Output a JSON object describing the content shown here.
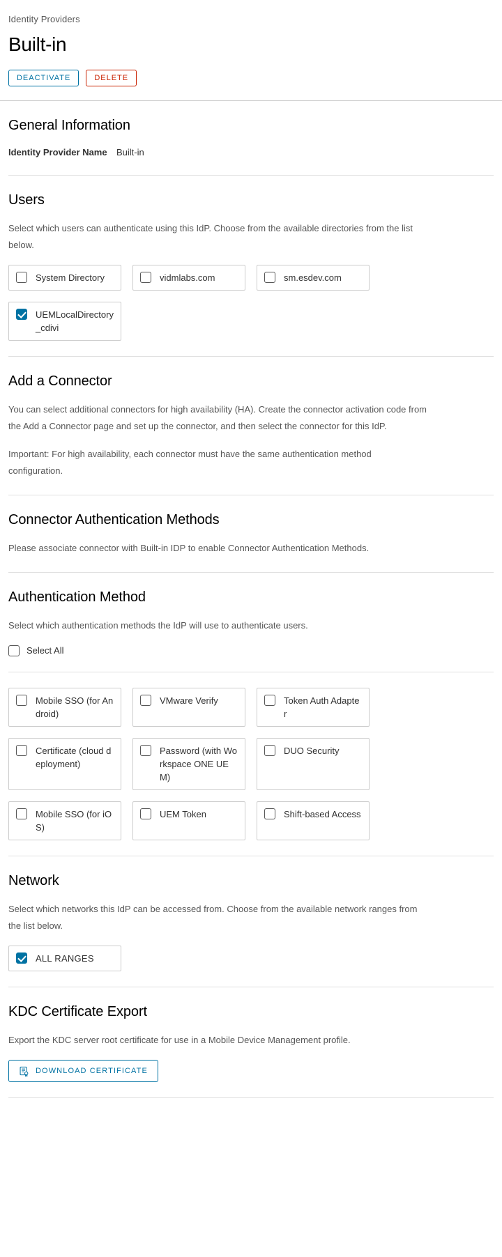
{
  "header": {
    "breadcrumb": "Identity Providers",
    "title": "Built-in",
    "deactivate_label": "DEACTIVATE",
    "delete_label": "DELETE"
  },
  "general_information": {
    "heading": "General Information",
    "idp_name_label": "Identity Provider Name",
    "idp_name_value": "Built-in"
  },
  "users": {
    "heading": "Users",
    "description": "Select which users can authenticate using this IdP. Choose from the available directories from the list below.",
    "directories": [
      {
        "label": "System Directory",
        "checked": false
      },
      {
        "label": "vidmlabs.com",
        "checked": false
      },
      {
        "label": "sm.esdev.com",
        "checked": false
      },
      {
        "label": "UEMLocalDirectory_cdivi",
        "checked": true
      }
    ]
  },
  "add_connector": {
    "heading": "Add a Connector",
    "description": "You can select additional connectors for high availability (HA). Create the connector activation code from the Add a Connector page and set up the connector, and then select the connector for this IdP.",
    "important": "Important: For high availability, each connector must have the same authentication method configuration."
  },
  "connector_auth_methods": {
    "heading": "Connector Authentication Methods",
    "description": "Please associate connector with Built-in IDP to enable Connector Authentication Methods."
  },
  "authentication_method": {
    "heading": "Authentication Method",
    "description": "Select which authentication methods the IdP will use to authenticate users.",
    "select_all_label": "Select All",
    "select_all_checked": false,
    "methods": [
      {
        "label": "Mobile SSO (for Android)",
        "checked": false
      },
      {
        "label": "VMware Verify",
        "checked": false
      },
      {
        "label": "Token Auth Adapter",
        "checked": false
      },
      {
        "label": "Certificate (cloud deployment)",
        "checked": false
      },
      {
        "label": "Password (with Workspace ONE UEM)",
        "checked": false
      },
      {
        "label": "DUO Security",
        "checked": false
      },
      {
        "label": "Mobile SSO (for iOS)",
        "checked": false
      },
      {
        "label": "UEM Token",
        "checked": false
      },
      {
        "label": "Shift-based Access",
        "checked": false
      }
    ]
  },
  "network": {
    "heading": "Network",
    "description": "Select which networks this IdP can be accessed from. Choose from the available network ranges from the list below.",
    "ranges": [
      {
        "label": "ALL RANGES",
        "checked": true
      }
    ]
  },
  "kdc_certificate_export": {
    "heading": "KDC Certificate Export",
    "description": "Export the KDC server root certificate for use in a Mobile Device Management profile.",
    "download_label": "DOWNLOAD CERTIFICATE"
  },
  "colors": {
    "accent": "#0072a3",
    "danger": "#c92100",
    "text": "#313131",
    "muted": "#565656",
    "border": "#cccccc"
  }
}
